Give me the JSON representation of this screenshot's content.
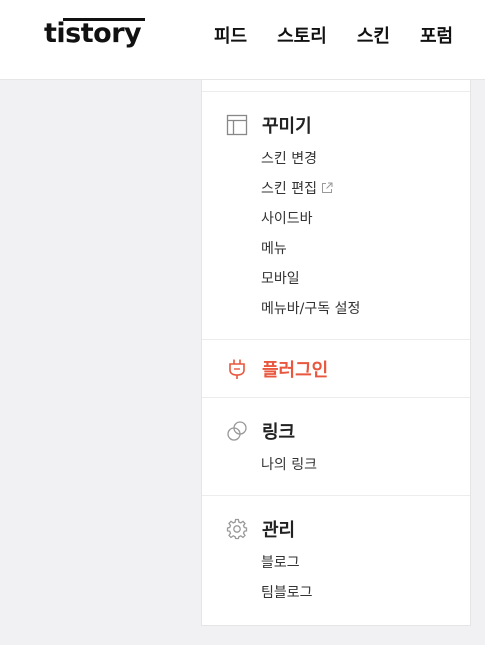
{
  "header": {
    "logo": "tistory",
    "nav": [
      "피드",
      "스토리",
      "스킨",
      "포럼"
    ]
  },
  "sidebar": {
    "decorate": {
      "icon": "layout-icon",
      "title": "꾸미기",
      "items": [
        "스킨 변경",
        "스킨 편집",
        "사이드바",
        "메뉴",
        "모바일",
        "메뉴바/구독 설정"
      ],
      "external_item_icon": "external-link-icon"
    },
    "plugin": {
      "icon": "plug-icon",
      "title": "플러그인",
      "color": "#e8573e"
    },
    "link": {
      "icon": "link-icon",
      "title": "링크",
      "items": [
        "나의 링크"
      ]
    },
    "manage": {
      "icon": "gear-icon",
      "title": "관리",
      "items": [
        "블로그",
        "팀블로그"
      ]
    }
  }
}
